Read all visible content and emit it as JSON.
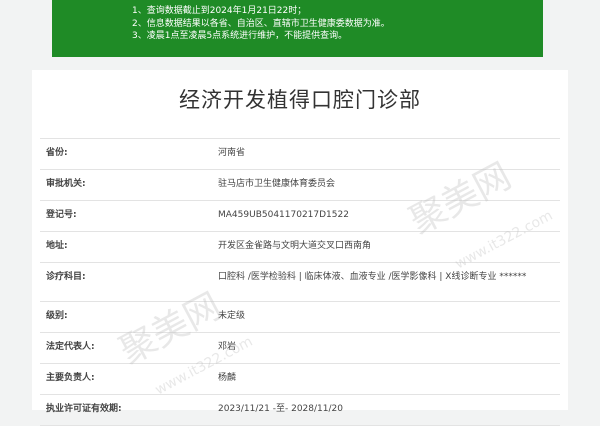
{
  "notice": {
    "line1": "1、查询数据截止到2024年1月21日22时；",
    "line2": "2、信息数据结果以各省、自治区、直辖市卫生健康委数据为准。",
    "line3": "3、凌晨1点至凌晨5点系统进行维护，不能提供查询。"
  },
  "title": "经济开发植得口腔门诊部",
  "rows": [
    {
      "label": "省份:",
      "value": "河南省"
    },
    {
      "label": "审批机关:",
      "value": "驻马店市卫生健康体育委员会"
    },
    {
      "label": "登记号:",
      "value": "MA459UB5041170217D1522"
    },
    {
      "label": "地址:",
      "value": "开发区金雀路与文明大道交叉口西南角"
    },
    {
      "label": "诊疗科目:",
      "value": "口腔科 /医学检验科 | 临床体液、血液专业 /医学影像科 | X线诊断专业 ******"
    },
    {
      "label": "级别:",
      "value": "未定级"
    },
    {
      "label": "法定代表人:",
      "value": "邓岩"
    },
    {
      "label": "主要负责人:",
      "value": "杨麟"
    },
    {
      "label": "执业许可证有效期:",
      "value": "2023/11/21 -至- 2028/11/20"
    }
  ],
  "watermark": {
    "text": "聚美网",
    "url": "www.it322.com"
  }
}
